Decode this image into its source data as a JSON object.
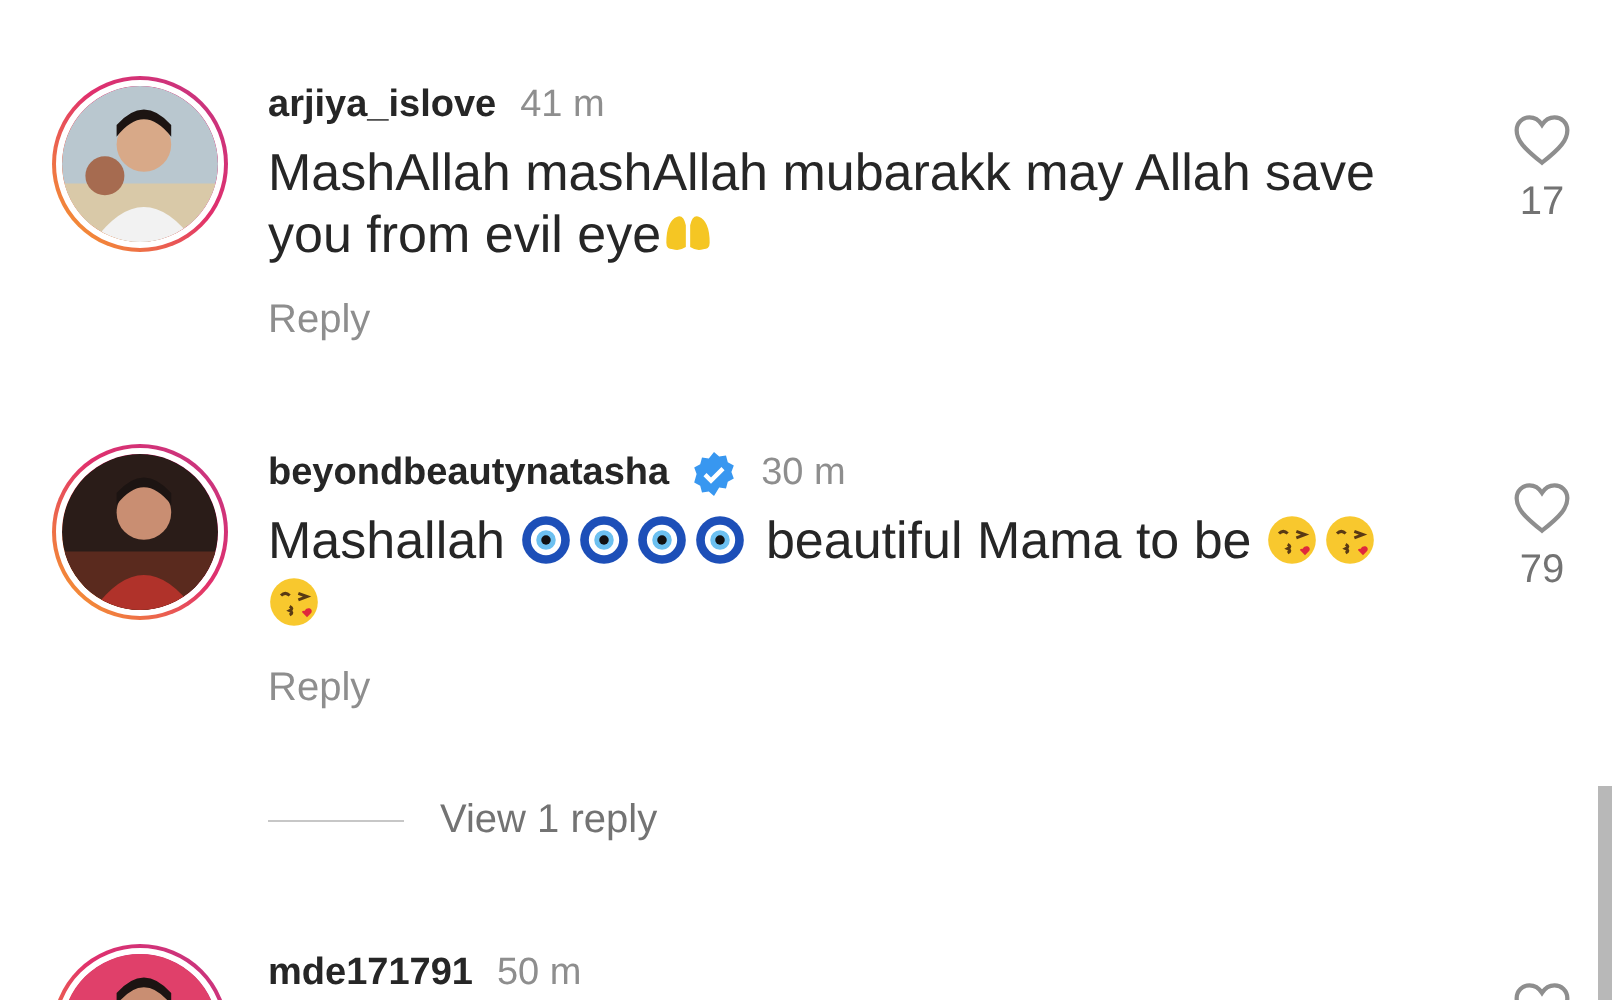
{
  "comments": [
    {
      "username": "arjiya_islove",
      "verified": false,
      "time": "41 m",
      "message": [
        {
          "kind": "text",
          "text": "MashAllah mashAllah mubarakk may Allah save you from evil eye"
        },
        {
          "kind": "palms"
        }
      ],
      "likes": "17",
      "reply": "Reply",
      "avatar": {
        "kind": "picture"
      }
    },
    {
      "username": "beyondbeautynatasha",
      "verified": true,
      "time": "30 m",
      "message": [
        {
          "kind": "text",
          "text": "Mashallah "
        },
        {
          "kind": "nazar"
        },
        {
          "kind": "nazar"
        },
        {
          "kind": "nazar"
        },
        {
          "kind": "nazar"
        },
        {
          "kind": "text",
          "text": " beautiful Mama to be "
        },
        {
          "kind": "kiss"
        },
        {
          "kind": "kiss"
        },
        {
          "kind": "kiss"
        }
      ],
      "likes": "79",
      "reply": "Reply",
      "view_replies": "View 1 reply",
      "avatar": {
        "kind": "picture"
      }
    },
    {
      "username": "mde171791",
      "verified": false,
      "time": "50 m",
      "avatar": {
        "kind": "picture"
      }
    }
  ]
}
